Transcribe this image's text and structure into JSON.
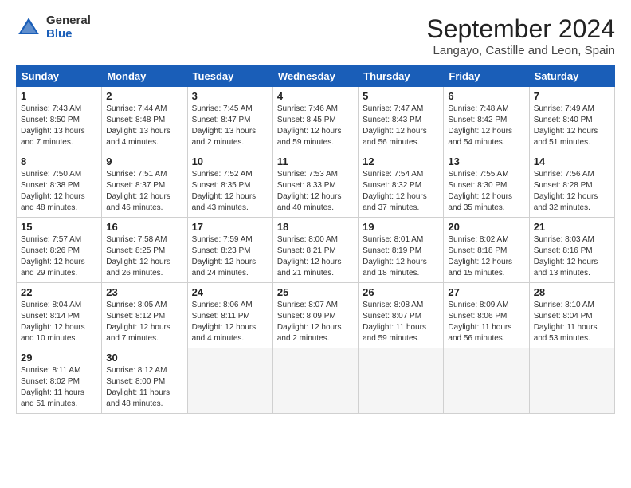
{
  "header": {
    "logo_general": "General",
    "logo_blue": "Blue",
    "month_title": "September 2024",
    "location": "Langayo, Castille and Leon, Spain"
  },
  "days_of_week": [
    "Sunday",
    "Monday",
    "Tuesday",
    "Wednesday",
    "Thursday",
    "Friday",
    "Saturday"
  ],
  "weeks": [
    [
      {
        "day": "1",
        "sunrise": "7:43 AM",
        "sunset": "8:50 PM",
        "daylight": "13 hours and 7 minutes."
      },
      {
        "day": "2",
        "sunrise": "7:44 AM",
        "sunset": "8:48 PM",
        "daylight": "13 hours and 4 minutes."
      },
      {
        "day": "3",
        "sunrise": "7:45 AM",
        "sunset": "8:47 PM",
        "daylight": "13 hours and 2 minutes."
      },
      {
        "day": "4",
        "sunrise": "7:46 AM",
        "sunset": "8:45 PM",
        "daylight": "12 hours and 59 minutes."
      },
      {
        "day": "5",
        "sunrise": "7:47 AM",
        "sunset": "8:43 PM",
        "daylight": "12 hours and 56 minutes."
      },
      {
        "day": "6",
        "sunrise": "7:48 AM",
        "sunset": "8:42 PM",
        "daylight": "12 hours and 54 minutes."
      },
      {
        "day": "7",
        "sunrise": "7:49 AM",
        "sunset": "8:40 PM",
        "daylight": "12 hours and 51 minutes."
      }
    ],
    [
      {
        "day": "8",
        "sunrise": "7:50 AM",
        "sunset": "8:38 PM",
        "daylight": "12 hours and 48 minutes."
      },
      {
        "day": "9",
        "sunrise": "7:51 AM",
        "sunset": "8:37 PM",
        "daylight": "12 hours and 46 minutes."
      },
      {
        "day": "10",
        "sunrise": "7:52 AM",
        "sunset": "8:35 PM",
        "daylight": "12 hours and 43 minutes."
      },
      {
        "day": "11",
        "sunrise": "7:53 AM",
        "sunset": "8:33 PM",
        "daylight": "12 hours and 40 minutes."
      },
      {
        "day": "12",
        "sunrise": "7:54 AM",
        "sunset": "8:32 PM",
        "daylight": "12 hours and 37 minutes."
      },
      {
        "day": "13",
        "sunrise": "7:55 AM",
        "sunset": "8:30 PM",
        "daylight": "12 hours and 35 minutes."
      },
      {
        "day": "14",
        "sunrise": "7:56 AM",
        "sunset": "8:28 PM",
        "daylight": "12 hours and 32 minutes."
      }
    ],
    [
      {
        "day": "15",
        "sunrise": "7:57 AM",
        "sunset": "8:26 PM",
        "daylight": "12 hours and 29 minutes."
      },
      {
        "day": "16",
        "sunrise": "7:58 AM",
        "sunset": "8:25 PM",
        "daylight": "12 hours and 26 minutes."
      },
      {
        "day": "17",
        "sunrise": "7:59 AM",
        "sunset": "8:23 PM",
        "daylight": "12 hours and 24 minutes."
      },
      {
        "day": "18",
        "sunrise": "8:00 AM",
        "sunset": "8:21 PM",
        "daylight": "12 hours and 21 minutes."
      },
      {
        "day": "19",
        "sunrise": "8:01 AM",
        "sunset": "8:19 PM",
        "daylight": "12 hours and 18 minutes."
      },
      {
        "day": "20",
        "sunrise": "8:02 AM",
        "sunset": "8:18 PM",
        "daylight": "12 hours and 15 minutes."
      },
      {
        "day": "21",
        "sunrise": "8:03 AM",
        "sunset": "8:16 PM",
        "daylight": "12 hours and 13 minutes."
      }
    ],
    [
      {
        "day": "22",
        "sunrise": "8:04 AM",
        "sunset": "8:14 PM",
        "daylight": "12 hours and 10 minutes."
      },
      {
        "day": "23",
        "sunrise": "8:05 AM",
        "sunset": "8:12 PM",
        "daylight": "12 hours and 7 minutes."
      },
      {
        "day": "24",
        "sunrise": "8:06 AM",
        "sunset": "8:11 PM",
        "daylight": "12 hours and 4 minutes."
      },
      {
        "day": "25",
        "sunrise": "8:07 AM",
        "sunset": "8:09 PM",
        "daylight": "12 hours and 2 minutes."
      },
      {
        "day": "26",
        "sunrise": "8:08 AM",
        "sunset": "8:07 PM",
        "daylight": "11 hours and 59 minutes."
      },
      {
        "day": "27",
        "sunrise": "8:09 AM",
        "sunset": "8:06 PM",
        "daylight": "11 hours and 56 minutes."
      },
      {
        "day": "28",
        "sunrise": "8:10 AM",
        "sunset": "8:04 PM",
        "daylight": "11 hours and 53 minutes."
      }
    ],
    [
      {
        "day": "29",
        "sunrise": "8:11 AM",
        "sunset": "8:02 PM",
        "daylight": "11 hours and 51 minutes."
      },
      {
        "day": "30",
        "sunrise": "8:12 AM",
        "sunset": "8:00 PM",
        "daylight": "11 hours and 48 minutes."
      },
      null,
      null,
      null,
      null,
      null
    ]
  ]
}
